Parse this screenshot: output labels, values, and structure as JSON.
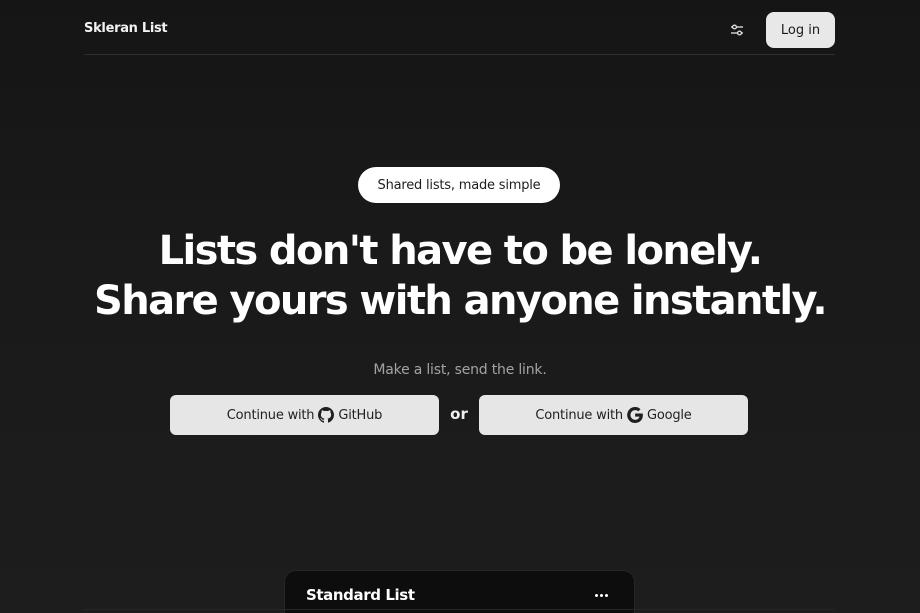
{
  "header": {
    "brand": "Skleran List",
    "settings_icon": "sliders-icon",
    "login_label": "Log in"
  },
  "hero": {
    "pill": "Shared lists, made simple",
    "headline_line1": "Lists don't have to be lonely.",
    "headline_line2": "Share yours with anyone instantly.",
    "subline": "Make a list, send the link.",
    "github_button": {
      "prefix": "Continue with",
      "provider": "GitHub",
      "icon": "github-icon"
    },
    "separator": "or",
    "google_button": {
      "prefix": "Continue with",
      "provider": "Google",
      "icon": "google-icon"
    }
  },
  "preview_card": {
    "title": "Standard List",
    "menu_icon": "more-horizontal-icon"
  },
  "colors": {
    "background": "#1a1a1a",
    "button_bg": "#e6e6e6",
    "pill_bg": "#ffffff",
    "subtle_text": "#a3a3a3"
  }
}
